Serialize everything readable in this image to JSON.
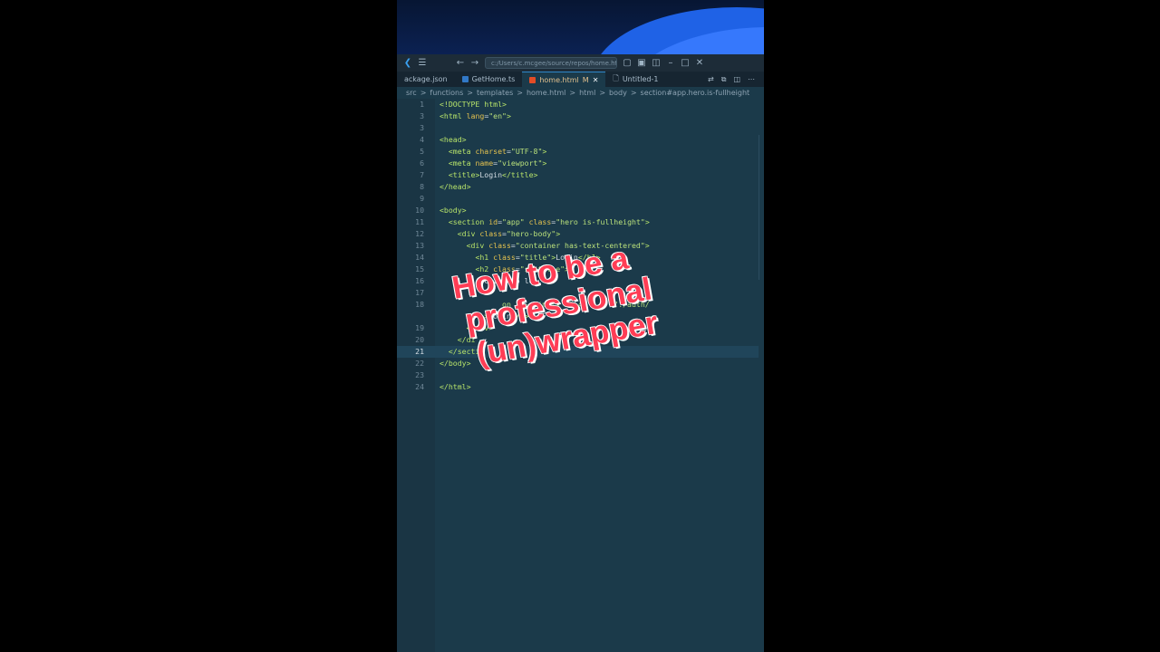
{
  "titlebar": {
    "command_center": "c:/Users/c.mcgee/source/repos/home.html"
  },
  "tabs": [
    {
      "label": "ackage.json",
      "active": false,
      "color": "#cbcb41"
    },
    {
      "label": "GetHome.ts",
      "active": false,
      "color": "#3178c6"
    },
    {
      "label": "home.html",
      "modified": "M",
      "active": true,
      "color": "#e34c26"
    },
    {
      "label": "Untitled-1",
      "active": false,
      "color": "#a9bccb"
    }
  ],
  "breadcrumbs": [
    "src",
    ">",
    "functions",
    ">",
    "templates",
    ">",
    "home.html",
    ">",
    "html",
    ">",
    "body",
    ">",
    "section#app.hero.is-fullheight"
  ],
  "code": {
    "lines": [
      {
        "n": "1",
        "html": "<span class='t'>&lt;!DOCTYPE html&gt;</span>"
      },
      {
        "n": "3",
        "html": "<span class='t'>&lt;html</span> <span class='a'>lang</span>=<span class='s'>\"en\"</span><span class='t'>&gt;</span>"
      },
      {
        "n": "3",
        "html": ""
      },
      {
        "n": "4",
        "html": "<span class='t'>&lt;head&gt;</span>"
      },
      {
        "n": "5",
        "html": "  <span class='t'>&lt;meta</span> <span class='a'>charset</span>=<span class='s'>\"UTF-8\"</span><span class='t'>&gt;</span>"
      },
      {
        "n": "6",
        "html": "  <span class='t'>&lt;meta</span> <span class='a'>name</span>=<span class='s'>\"viewport\"</span><span class='t'>&gt;</span>"
      },
      {
        "n": "7",
        "html": "  <span class='t'>&lt;title&gt;</span>Login<span class='t'>&lt;/title&gt;</span>"
      },
      {
        "n": "8",
        "html": "<span class='t'>&lt;/head&gt;</span>"
      },
      {
        "n": "9",
        "html": ""
      },
      {
        "n": "10",
        "html": "<span class='t'>&lt;body&gt;</span>"
      },
      {
        "n": "11",
        "html": "  <span class='t'>&lt;section</span> <span class='a'>id</span>=<span class='s'>\"app\"</span> <span class='a'>class</span>=<span class='s'>\"hero is-fullheight\"</span><span class='t'>&gt;</span>"
      },
      {
        "n": "12",
        "html": "    <span class='t'>&lt;div</span> <span class='a'>class</span>=<span class='s'>\"hero-body\"</span><span class='t'>&gt;</span>"
      },
      {
        "n": "13",
        "html": "      <span class='t'>&lt;div</span> <span class='a'>class</span>=<span class='s'>\"container has-text-centered\"</span><span class='t'>&gt;</span>"
      },
      {
        "n": "14",
        "html": "        <span class='t'>&lt;h1</span> <span class='a'>class</span>=<span class='s'>\"title\"</span><span class='t'>&gt;</span>Login<span class='t'>&lt;/h1&gt;</span>"
      },
      {
        "n": "15",
        "html": "        <span class='t'>&lt;h2</span> <span class='a'>class</span>=<span class='s'>\"subtitle\"</span><span class='t'>&gt;</span>"
      },
      {
        "n": "16",
        "html": "          Click to lo"
      },
      {
        "n": "17",
        "html": ""
      },
      {
        "n": "18",
        "html": "              <span class='s'>on is-primary mt-4\"</span>      <span class='s'>\"./auth/</span>"
      },
      {
        "n": "",
        "html": "          <span class='t'>&gt;</span>Login<span class='t'>&lt;/a&gt;</span>"
      },
      {
        "n": "19",
        "html": "      <span class='t'>&lt;/div&gt;</span>"
      },
      {
        "n": "20",
        "html": "    <span class='t'>&lt;/di</span>"
      },
      {
        "n": "21",
        "html": "  <span class='t'>&lt;/secti</span>",
        "current": true
      },
      {
        "n": "22",
        "html": "<span class='t'>&lt;/body&gt;</span>"
      },
      {
        "n": "23",
        "html": ""
      },
      {
        "n": "24",
        "html": "<span class='t'>&lt;/html&gt;</span>"
      }
    ]
  },
  "overlay": {
    "lines": [
      "How to be a",
      "professional",
      "(un)wrapper"
    ],
    "color": "#ff3d55"
  }
}
